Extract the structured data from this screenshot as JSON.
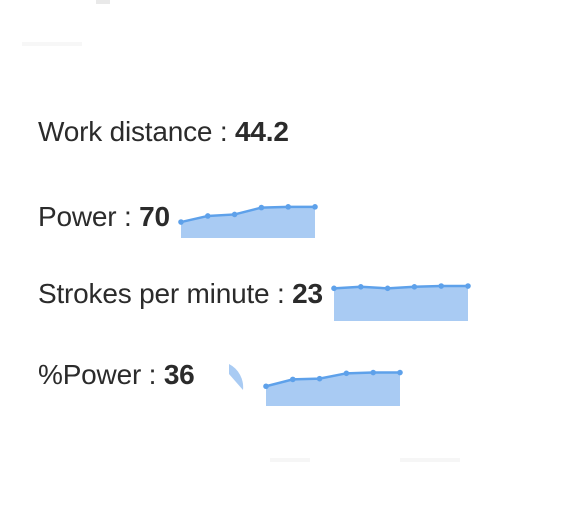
{
  "stats": [
    {
      "label": "Work distance",
      "separator": " : ",
      "value": "44.2",
      "sparkline": null
    },
    {
      "label": "Power",
      "separator": " : ",
      "value": "70",
      "sparkline": [
        0.42,
        0.58,
        0.62,
        0.8,
        0.82,
        0.82
      ]
    },
    {
      "label": "Strokes per minute",
      "separator": " : ",
      "value": "23",
      "sparkline": [
        0.86,
        0.9,
        0.86,
        0.9,
        0.92,
        0.92
      ]
    },
    {
      "label": "%Power",
      "separator": " : ",
      "value": "36",
      "sparkline": [
        0.52,
        0.7,
        0.72,
        0.86,
        0.88,
        0.88
      ]
    }
  ],
  "colors": {
    "text": "#2b2b2b",
    "spark_fill": "#a9cbf3",
    "spark_line": "#5ea1ea",
    "gauge_fill": "#a9cbf3"
  },
  "icons": {
    "gauge": "partial-pie-gauge-icon"
  }
}
